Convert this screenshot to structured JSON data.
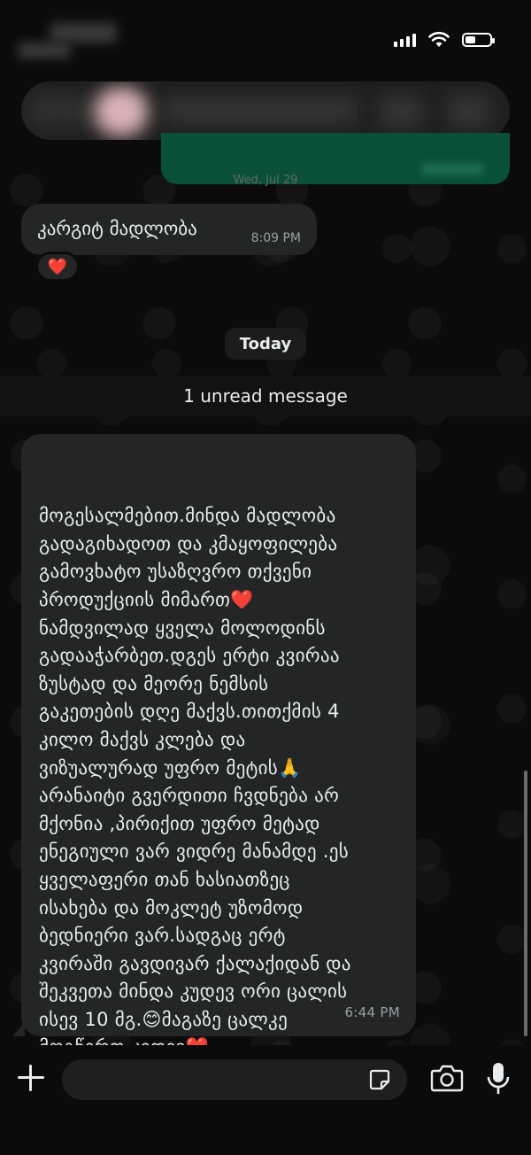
{
  "status_bar": {
    "battery_level": 0.35
  },
  "chat": {
    "date_separator_faint": "Wed, Jul 29",
    "messages": [
      {
        "id": "m1",
        "direction": "incoming",
        "text": "კარგიტ მადლობა",
        "time": "8:09 PM",
        "reaction": "❤️"
      },
      {
        "id": "m2",
        "direction": "incoming",
        "text": "მოგესალმებით.მინდა მადლობა\nგადაგიხადოთ და  კმაყოფილება\nგამოვხატო უსაზღვრო თქვენი\nპროდუქციის მიმართ❤️\nნამდვილად ყველა მოლოდინს\nგადააჭარბეთ.დგეს ერტი კვირაა\nზუსტად და მეორე ნემსის\nგაკეთების დღე მაქვს.თითქმის 4\nკილო მაქვს კლება და\nვიზუალურად უფრო მეტის🙏\nარანაიტი გვერდითი ჩვდნება არ\nმქონია ,პირიქით უფრო მეტად\nენეგიული ვარ ვიდრე მანამდე .ეს\nყველაფერი თან ხასიათზეც\nისახება და მოკლეტ უზომოდ\nბედნიერი ვარ.სადგაც ერტ\nკვირაში გავდივარ ქალაქიდან და\nშეკვეთა მინდა კუდევ ორი ცალის\nისევ 10 მგ.😊მაგაზე ცალკე\nმოგწერთ კიდევ❤️",
        "time": "6:44 PM"
      }
    ],
    "day_label": "Today",
    "unread_label": "1 unread message"
  },
  "composer": {
    "placeholder": ""
  },
  "colors": {
    "background": "#0b0b0b",
    "incoming_bubble": "#242626",
    "outgoing_bubble": "#0a4f38",
    "text": "#e9edef",
    "time": "#9aa0a3",
    "heart": "#e5253d"
  },
  "icons": [
    "signal-icon",
    "wifi-icon",
    "battery-icon",
    "plus-icon",
    "sticker-icon",
    "camera-icon",
    "microphone-icon"
  ]
}
